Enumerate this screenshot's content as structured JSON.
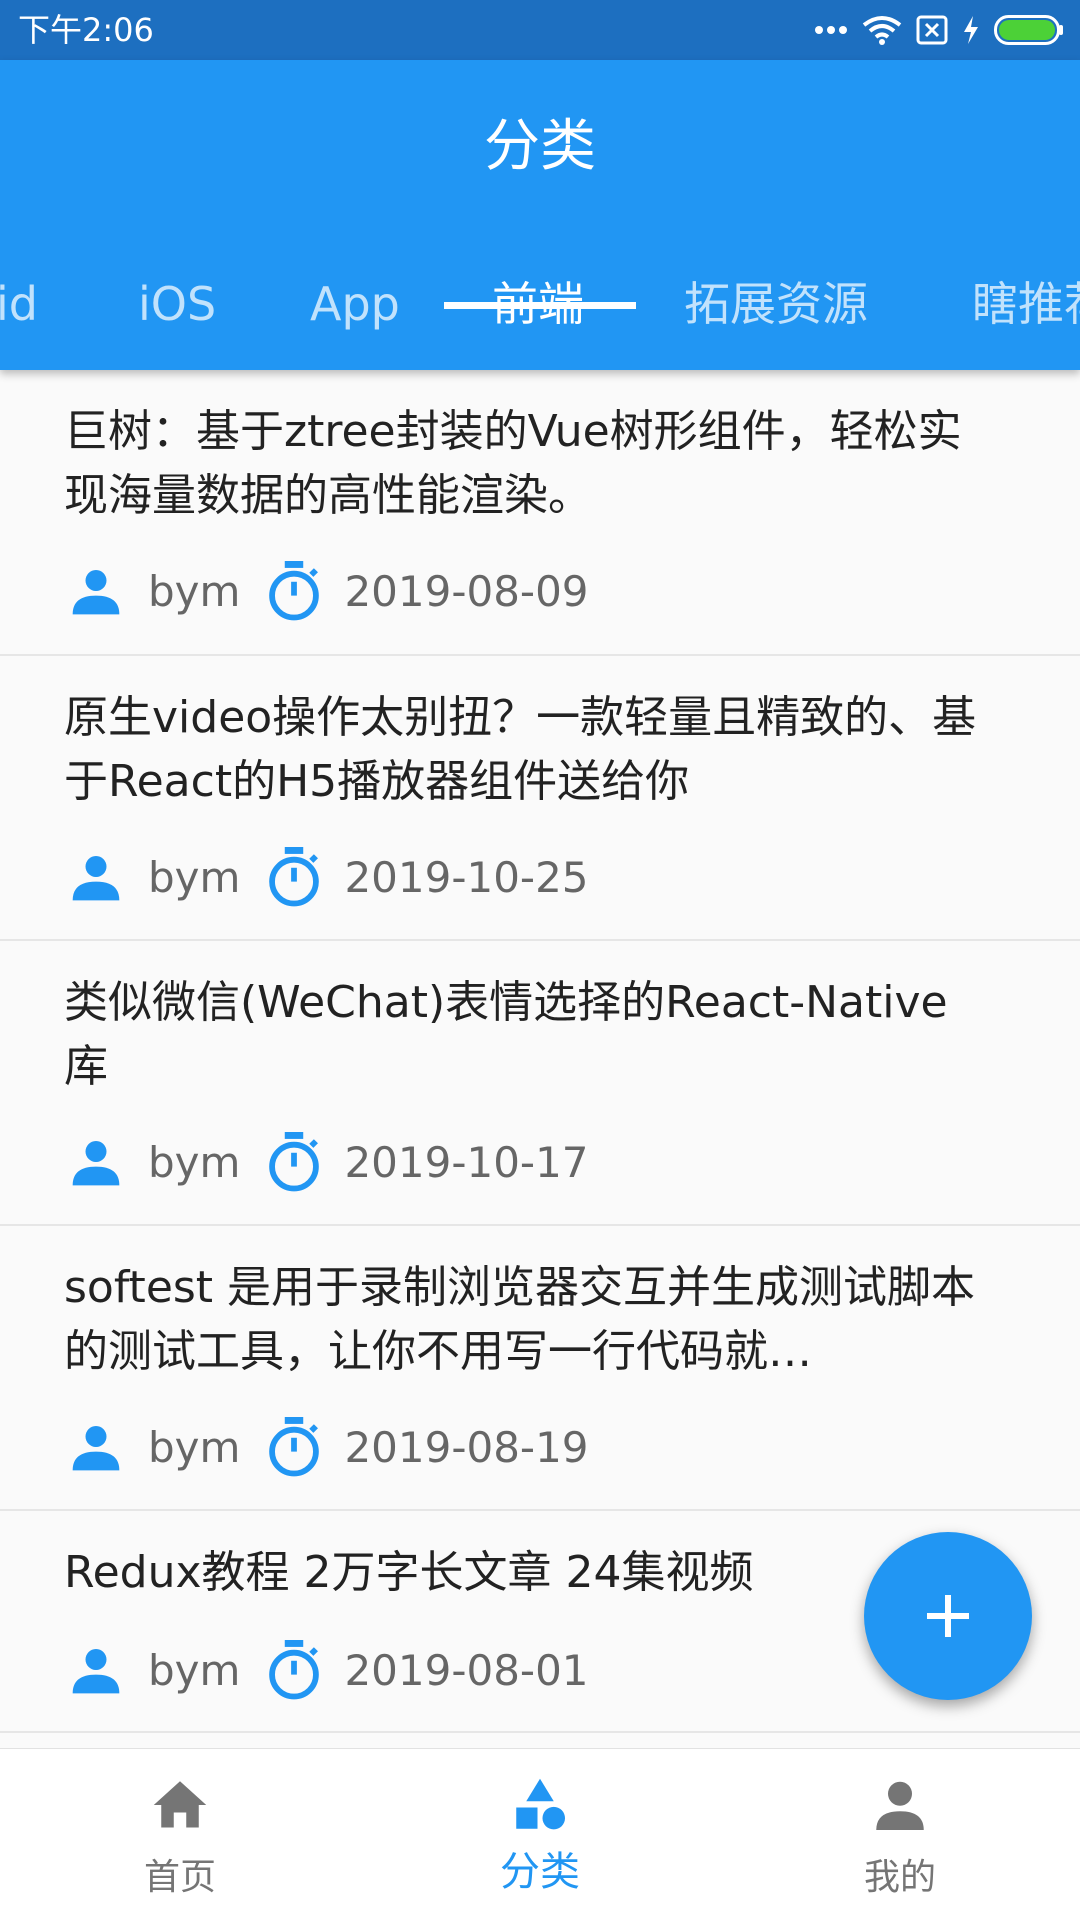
{
  "status_bar": {
    "time": "下午2:06"
  },
  "app_bar": {
    "title": "分类"
  },
  "tabs": [
    {
      "label": "id"
    },
    {
      "label": "iOS"
    },
    {
      "label": "App"
    },
    {
      "label": "前端",
      "selected": true
    },
    {
      "label": "拓展资源"
    },
    {
      "label": "瞎推荐"
    }
  ],
  "articles": [
    {
      "title": "巨树：基于ztree封装的Vue树形组件，轻松实现海量数据的高性能渲染。",
      "author": "bym",
      "date": "2019-08-09"
    },
    {
      "title": "原生video操作太别扭？一款轻量且精致的、基于React的H5播放器组件送给你",
      "author": "bym",
      "date": "2019-10-25"
    },
    {
      "title": "类似微信(WeChat)表情选择的React-Native库",
      "author": "bym",
      "date": "2019-10-17"
    },
    {
      "title": "softest 是用于录制浏览器交互并生成测试脚本的测试工具，让你不用写一行代码就…",
      "author": "bym",
      "date": "2019-08-19"
    },
    {
      "title": "Redux教程 2万字长文章 24集视频",
      "author": "bym",
      "date": "2019-08-01"
    }
  ],
  "bottom_nav": [
    {
      "label": "首页",
      "icon": "home-icon"
    },
    {
      "label": "分类",
      "icon": "category-icon",
      "active": true
    },
    {
      "label": "我的",
      "icon": "person-icon"
    }
  ],
  "colors": {
    "primary": "#2196f3",
    "status_bar": "#1d6fc0",
    "battery": "#4cd137"
  }
}
